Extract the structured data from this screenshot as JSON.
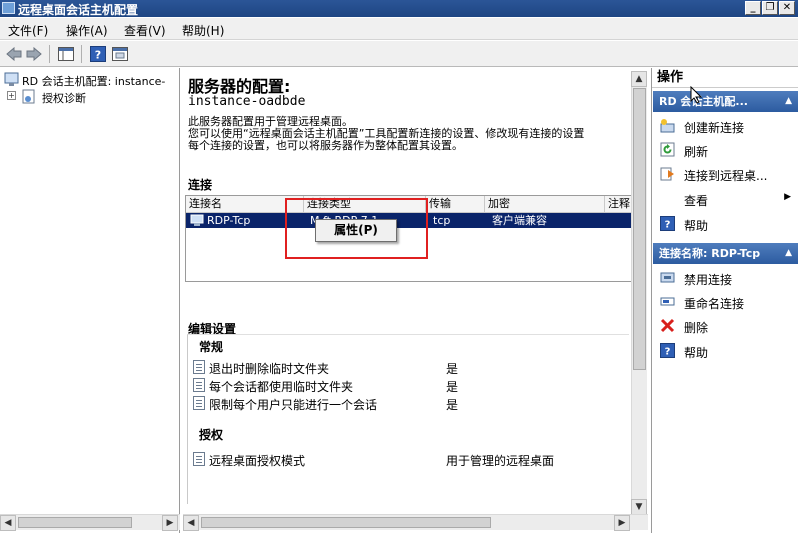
{
  "window": {
    "title": "远程桌面会话主机配置"
  },
  "window_controls": {
    "minimize": "_",
    "restore": "❐",
    "close": "✕"
  },
  "menu": [
    "文件(F)",
    "操作(A)",
    "查看(V)",
    "帮助(H)"
  ],
  "toolbar": {
    "icons": [
      "back-icon",
      "forward-icon",
      "show-hide-tree-icon",
      "help-icon",
      "properties-icon"
    ]
  },
  "tree": {
    "root": "RD 会话主机配置: instance-",
    "child": "授权诊断"
  },
  "center": {
    "title": "服务器的配置:",
    "server": "instance-oadbde",
    "desc1": "此服务器配置用于管理远程桌面。",
    "desc2": "您可以使用“远程桌面会话主机配置”工具配置新连接的设置、修改现有连接的设置",
    "desc3": "每个连接的设置，也可以将服务器作为整体配置其设置。",
    "connections_label": "连接",
    "columns": [
      "连接名",
      "连接类型",
      "传输",
      "加密",
      "注释"
    ],
    "row": {
      "name": "RDP-Tcp",
      "type": "Microsoft RDP 7.1",
      "type_visible": "M      ft RDP 7.1",
      "transport": "tcp",
      "encryption": "客户端兼容"
    },
    "popup": "属性(P)",
    "edit_settings_label": "编辑设置",
    "general_label": "常规",
    "settings": [
      {
        "label": "退出时删除临时文件夹",
        "value": "是"
      },
      {
        "label": "每个会话都使用临时文件夹",
        "value": "是"
      },
      {
        "label": "限制每个用户只能进行一个会话",
        "value": "是"
      }
    ],
    "licensing_label": "授权",
    "licensing": {
      "label": "远程桌面授权模式",
      "value": "用于管理的远程桌面"
    }
  },
  "actions": {
    "title": "操作",
    "section1": "RD 会话主机配...",
    "section1_items": [
      "创建新连接",
      "刷新",
      "连接到远程桌...",
      "查看",
      "帮助"
    ],
    "section2": "连接名称: RDP-Tcp",
    "section2_items": [
      "禁用连接",
      "重命名连接",
      "删除",
      "帮助"
    ]
  },
  "colors": {
    "selection": "#0a246a",
    "title_bar": "#1e4683",
    "highlight_box": "#e02020",
    "section_header": "#3a67ab"
  }
}
